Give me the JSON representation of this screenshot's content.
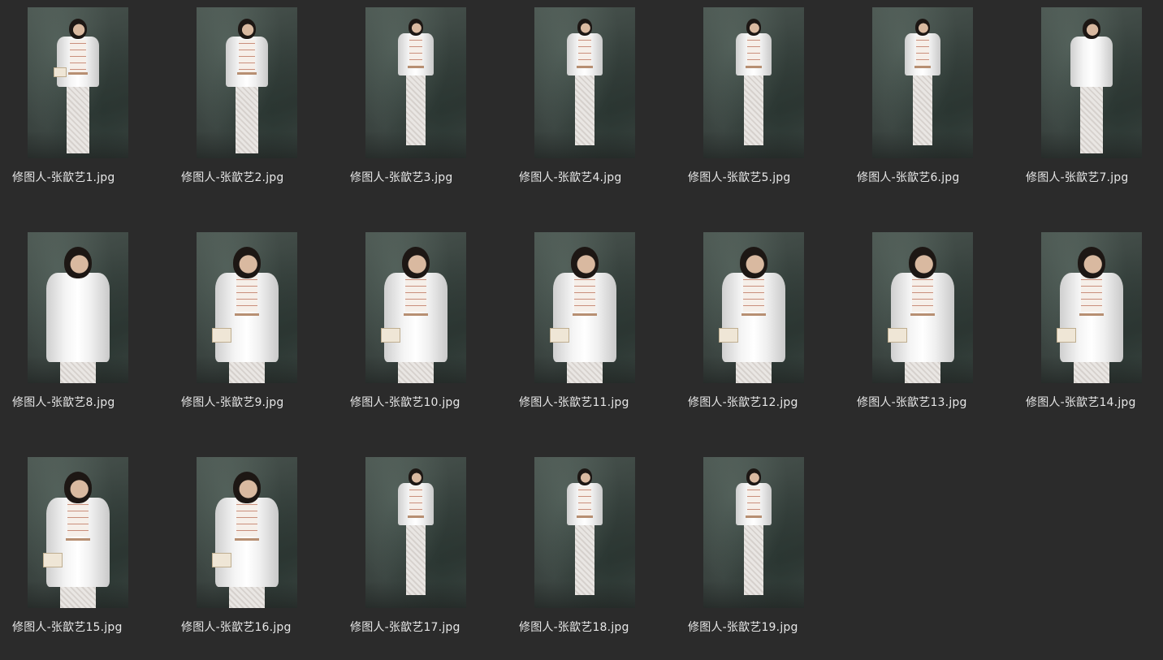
{
  "window": {
    "view": "icon-grid"
  },
  "files": [
    {
      "name": "修图人-张歆艺1.jpg",
      "pose": "full-bag"
    },
    {
      "name": "修图人-张歆艺2.jpg",
      "pose": "full"
    },
    {
      "name": "修图人-张歆艺3.jpg",
      "pose": "full-far"
    },
    {
      "name": "修图人-张歆艺4.jpg",
      "pose": "full-far"
    },
    {
      "name": "修图人-张歆艺5.jpg",
      "pose": "full-far"
    },
    {
      "name": "修图人-张歆艺6.jpg",
      "pose": "full-far"
    },
    {
      "name": "修图人-张歆艺7.jpg",
      "pose": "back"
    },
    {
      "name": "修图人-张歆艺8.jpg",
      "pose": "half-side"
    },
    {
      "name": "修图人-张歆艺9.jpg",
      "pose": "half-bag"
    },
    {
      "name": "修图人-张歆艺10.jpg",
      "pose": "half-bag"
    },
    {
      "name": "修图人-张歆艺11.jpg",
      "pose": "half-bag"
    },
    {
      "name": "修图人-张歆艺12.jpg",
      "pose": "half-bag"
    },
    {
      "name": "修图人-张歆艺13.jpg",
      "pose": "half-bag"
    },
    {
      "name": "修图人-张歆艺14.jpg",
      "pose": "half-bag"
    },
    {
      "name": "修图人-张歆艺15.jpg",
      "pose": "half-bag"
    },
    {
      "name": "修图人-张歆艺16.jpg",
      "pose": "half-bag"
    },
    {
      "name": "修图人-张歆艺17.jpg",
      "pose": "full-far"
    },
    {
      "name": "修图人-张歆艺18.jpg",
      "pose": "full-far"
    },
    {
      "name": "修图人-张歆艺19.jpg",
      "pose": "full-far"
    }
  ],
  "colors": {
    "background": "#2b2b2b",
    "label_text": "#e6e6e6",
    "backdrop": "#3f4945"
  }
}
